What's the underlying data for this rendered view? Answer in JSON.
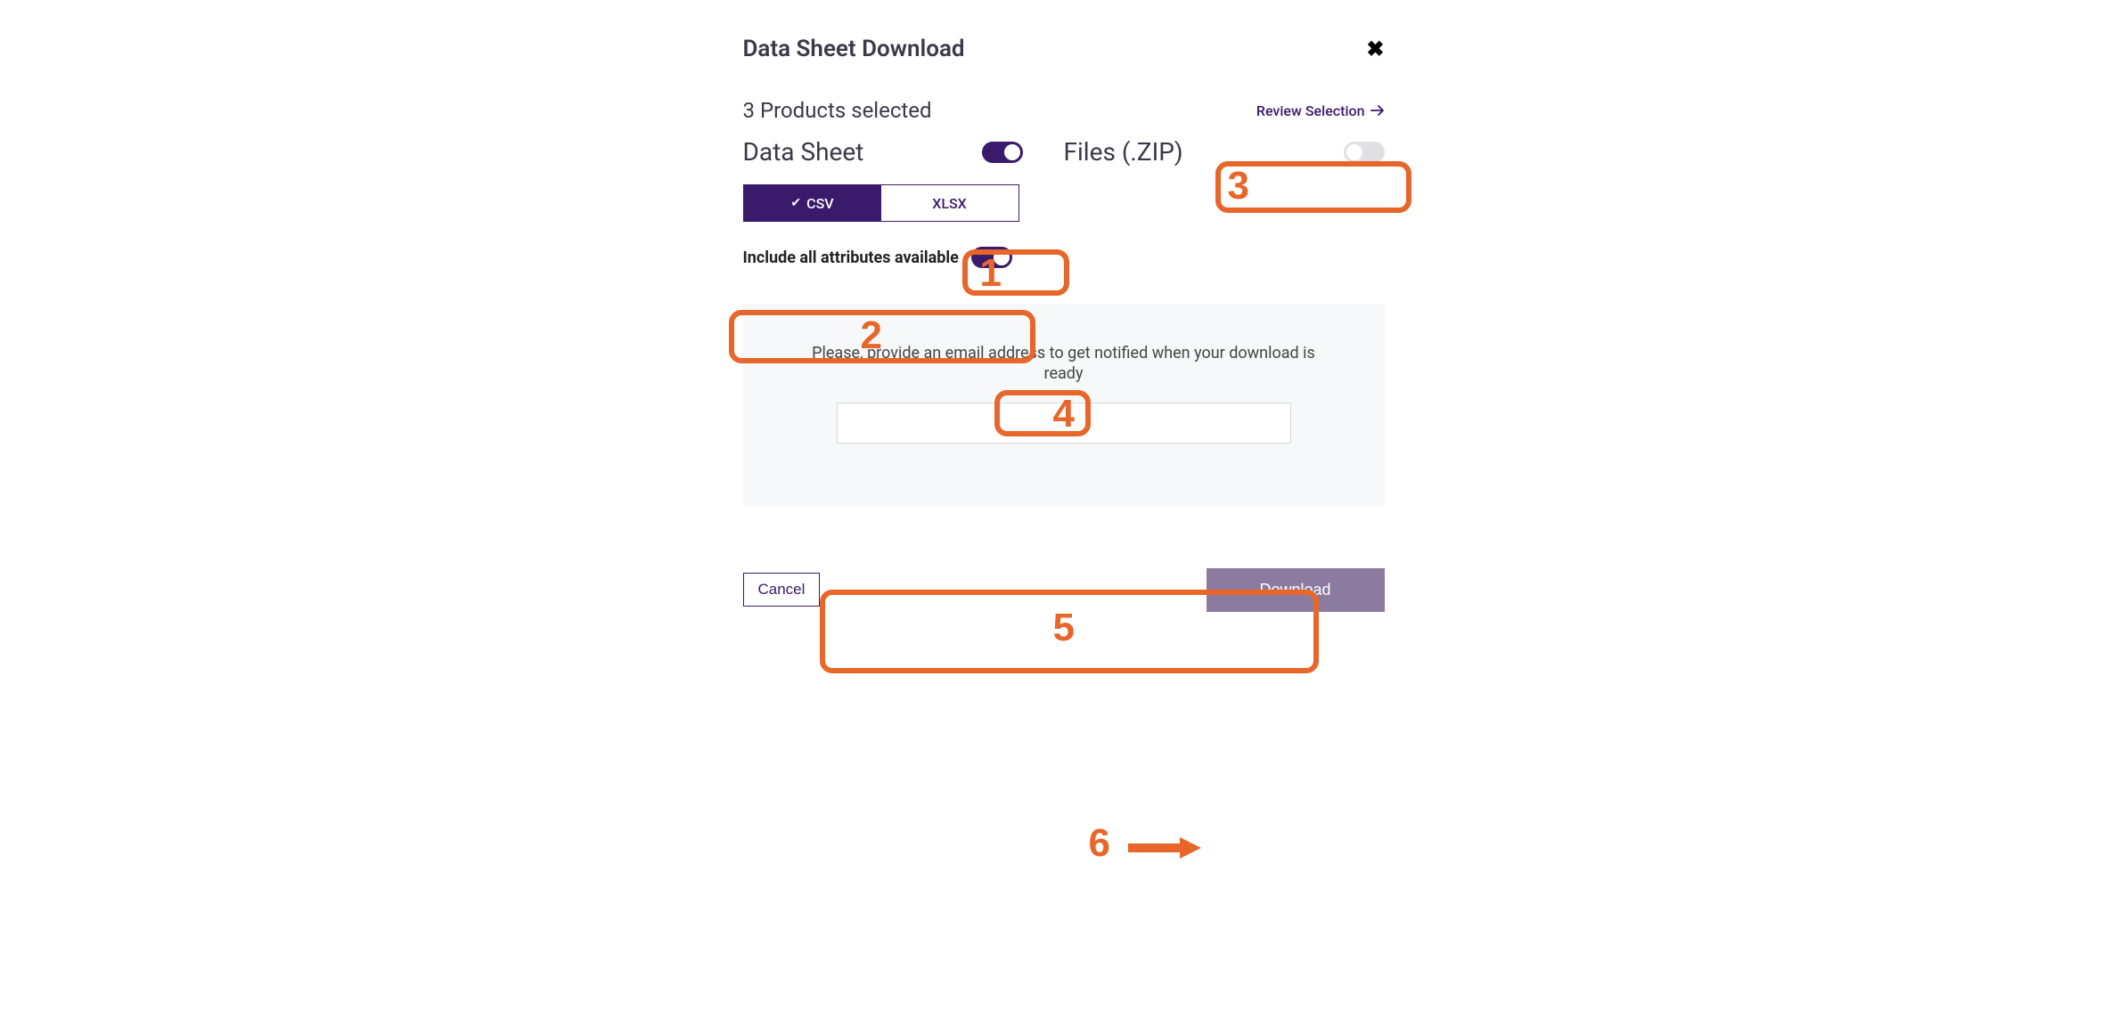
{
  "modal": {
    "title": "Data Sheet Download",
    "products_selected": "3 Products selected",
    "review_selection": "Review Selection",
    "data_sheet_label": "Data Sheet",
    "files_label": "Files (.ZIP)",
    "format": {
      "csv": "CSV",
      "xlsx": "XLSX"
    },
    "include_attributes_label": "Include all attributes available",
    "email_prompt": "Please, provide an email address to get notified when your download is ready",
    "cancel_label": "Cancel",
    "download_label": "Download"
  },
  "annotations": {
    "n1": "1",
    "n2": "2",
    "n3": "3",
    "n4": "4",
    "n5": "5",
    "n6": "6"
  }
}
